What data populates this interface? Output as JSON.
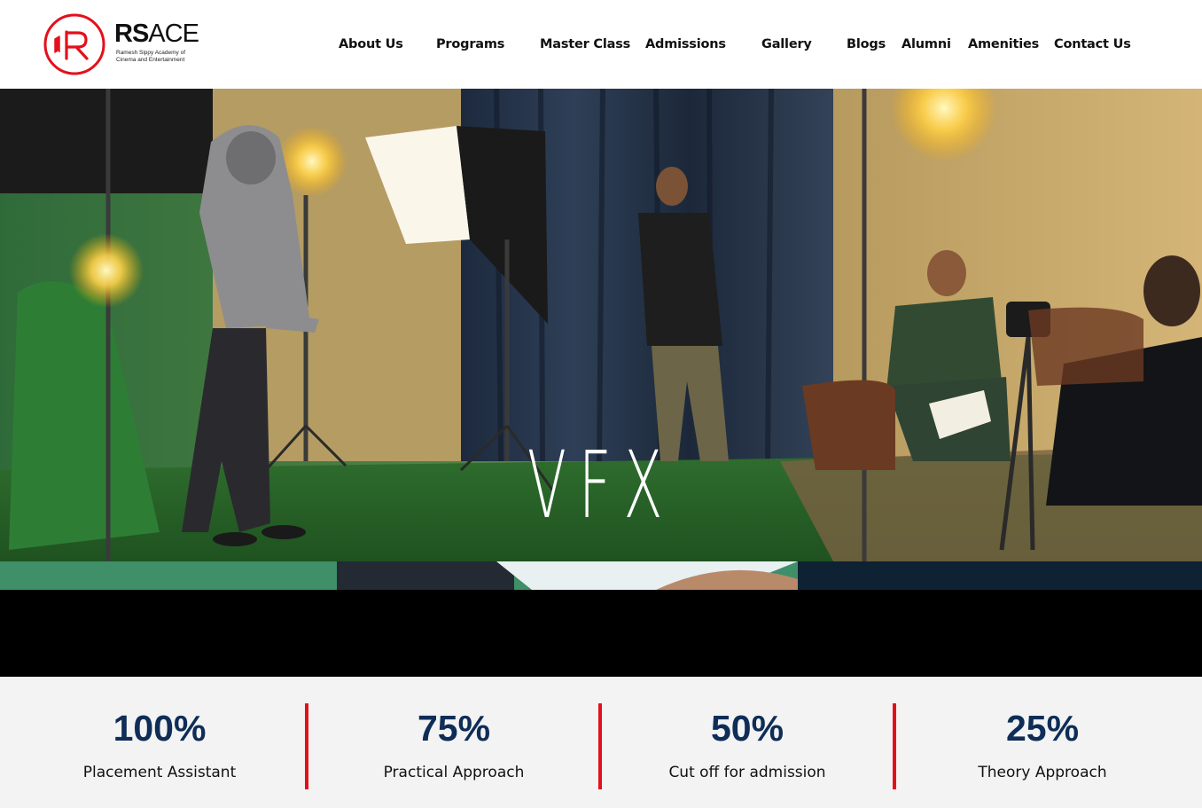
{
  "brand": {
    "name_bold": "RS",
    "name_light": "ACE",
    "tagline_line1": "Ramesh Sippy Academy of",
    "tagline_line2": "Cinema and Entertainment",
    "accent_color": "#e3101b"
  },
  "nav": {
    "items": [
      "About Us",
      "Programs",
      "Master Class",
      "Admissions",
      "Gallery",
      "Blogs",
      "Alumni",
      "Amenities",
      "Contact Us"
    ]
  },
  "hero": {
    "title": "VFX"
  },
  "stats": [
    {
      "value": "100%",
      "label": "Placement Assistant"
    },
    {
      "value": "75%",
      "label": "Practical Approach"
    },
    {
      "value": "50%",
      "label": "Cut off for admission"
    },
    {
      "value": "25%",
      "label": "Theory Approach"
    }
  ],
  "colors": {
    "stat_value": "#0e2d57",
    "divider": "#e3101b",
    "stats_bg": "#f3f3f3"
  }
}
